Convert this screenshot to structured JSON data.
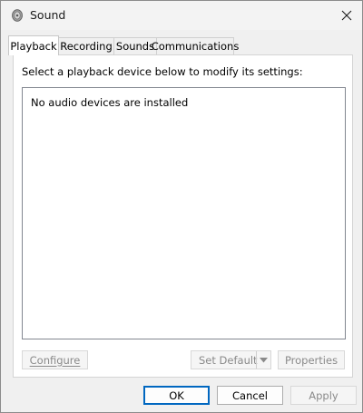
{
  "window": {
    "title": "Sound",
    "icon": "speaker-icon"
  },
  "tabs": [
    {
      "label": "Playback",
      "active": true
    },
    {
      "label": "Recording",
      "active": false
    },
    {
      "label": "Sounds",
      "active": false
    },
    {
      "label": "Communications",
      "active": false
    }
  ],
  "playback": {
    "instruction": "Select a playback device below to modify its settings:",
    "empty_message": "No audio devices are installed",
    "buttons": {
      "configure": "Configure",
      "set_default": "Set Default",
      "properties": "Properties"
    }
  },
  "dialog_buttons": {
    "ok": "OK",
    "cancel": "Cancel",
    "apply": "Apply"
  },
  "colors": {
    "accent": "#0067c0",
    "disabled_text": "#8a8a8a"
  }
}
